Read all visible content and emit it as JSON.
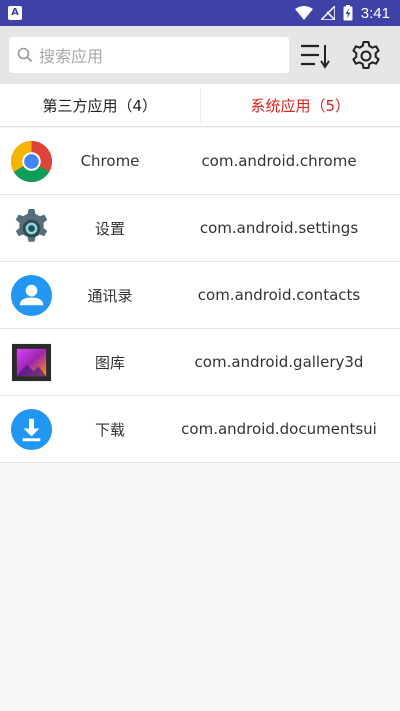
{
  "status_bar": {
    "time": "3:41",
    "left_icon_letter": "A",
    "icons": [
      "wifi-icon",
      "signal-off-icon",
      "battery-charging-icon"
    ]
  },
  "search": {
    "placeholder": "搜索应用",
    "value": ""
  },
  "toolbar": {
    "sort_icon": "sort-list-icon",
    "settings_icon": "gear-icon"
  },
  "tabs": [
    {
      "label": "第三方应用（4）",
      "active": false
    },
    {
      "label": "系统应用（5）",
      "active": true
    }
  ],
  "colors": {
    "status_bar": "#3f42a6",
    "active_tab": "#e0211a",
    "header_bg": "#e6e6e6"
  },
  "apps": [
    {
      "name": "Chrome",
      "package": "com.android.chrome",
      "icon": "chrome-icon"
    },
    {
      "name": "设置",
      "package": "com.android.settings",
      "icon": "settings-gear-icon"
    },
    {
      "name": "通讯录",
      "package": "com.android.contacts",
      "icon": "contacts-icon"
    },
    {
      "name": "图库",
      "package": "com.android.gallery3d",
      "icon": "gallery-icon"
    },
    {
      "name": "下载",
      "package": "com.android.documentsui",
      "icon": "download-icon"
    }
  ]
}
